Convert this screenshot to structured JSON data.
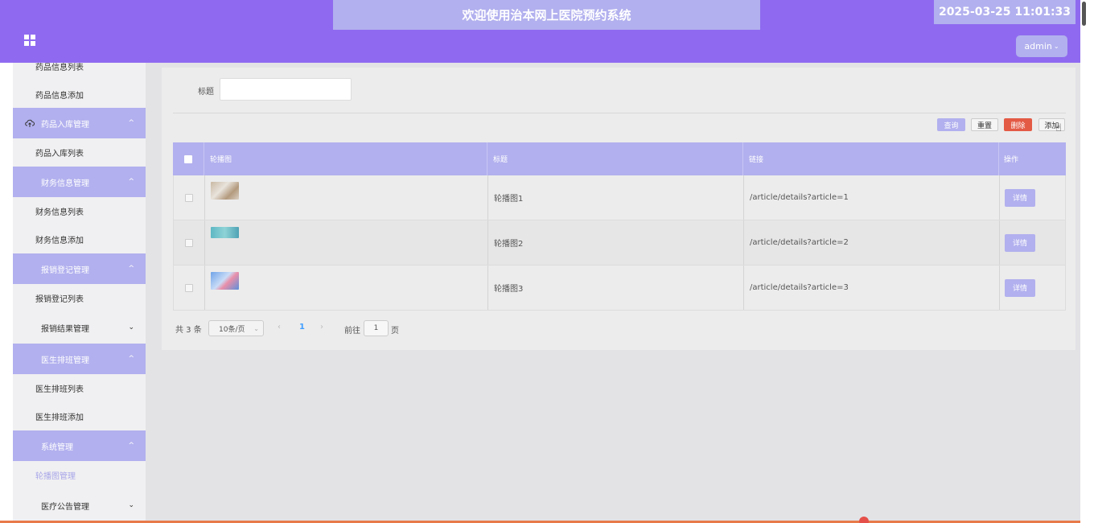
{
  "header": {
    "title": "欢迎使用治本网上医院预约系统",
    "datetime": "2025-03-25 11:01:33",
    "user_menu": "admin"
  },
  "sidebar": {
    "items": [
      {
        "type": "sub",
        "label": "药品信息列表"
      },
      {
        "type": "sub",
        "label": "药品信息添加"
      },
      {
        "type": "group",
        "label": "药品入库管理",
        "icon": "cloud-upload-icon",
        "expanded": true
      },
      {
        "type": "sub",
        "label": "药品入库列表"
      },
      {
        "type": "group",
        "label": "财务信息管理",
        "expanded": true
      },
      {
        "type": "sub",
        "label": "财务信息列表"
      },
      {
        "type": "sub",
        "label": "财务信息添加"
      },
      {
        "type": "group",
        "label": "报销登记管理",
        "expanded": true
      },
      {
        "type": "sub",
        "label": "报销登记列表"
      },
      {
        "type": "closed",
        "label": "报销结果管理",
        "expanded": false
      },
      {
        "type": "group",
        "label": "医生排班管理",
        "expanded": true
      },
      {
        "type": "sub",
        "label": "医生排班列表"
      },
      {
        "type": "sub",
        "label": "医生排班添加"
      },
      {
        "type": "group",
        "label": "系统管理",
        "expanded": true
      },
      {
        "type": "sub",
        "label": "轮播图管理",
        "active": true
      },
      {
        "type": "closed",
        "label": "医疗公告管理",
        "expanded": false
      }
    ]
  },
  "search": {
    "label": "标题",
    "value": ""
  },
  "toolbar": {
    "query": "查询",
    "reset": "重置",
    "delete": "删除",
    "add": "添加"
  },
  "table": {
    "columns": [
      "轮播图",
      "标题",
      "链接",
      "操作"
    ],
    "rows": [
      {
        "image": "thumbnail-corridor",
        "title": "轮播图1",
        "link": "/article/details?article=1",
        "action": "详情"
      },
      {
        "image": "thumbnail-teal",
        "title": "轮播图2",
        "link": "/article/details?article=2",
        "action": "详情"
      },
      {
        "image": "thumbnail-blue",
        "title": "轮播图3",
        "link": "/article/details?article=3",
        "action": "详情"
      }
    ]
  },
  "pagination": {
    "total": "共 3 条",
    "page_size": "10条/页",
    "current_page": "1",
    "goto_label": "前往",
    "goto_value": "1",
    "goto_suffix": "页"
  },
  "colors": {
    "header": "#8f6af0",
    "accent": "#b2b0ee",
    "danger": "#e35a45"
  }
}
